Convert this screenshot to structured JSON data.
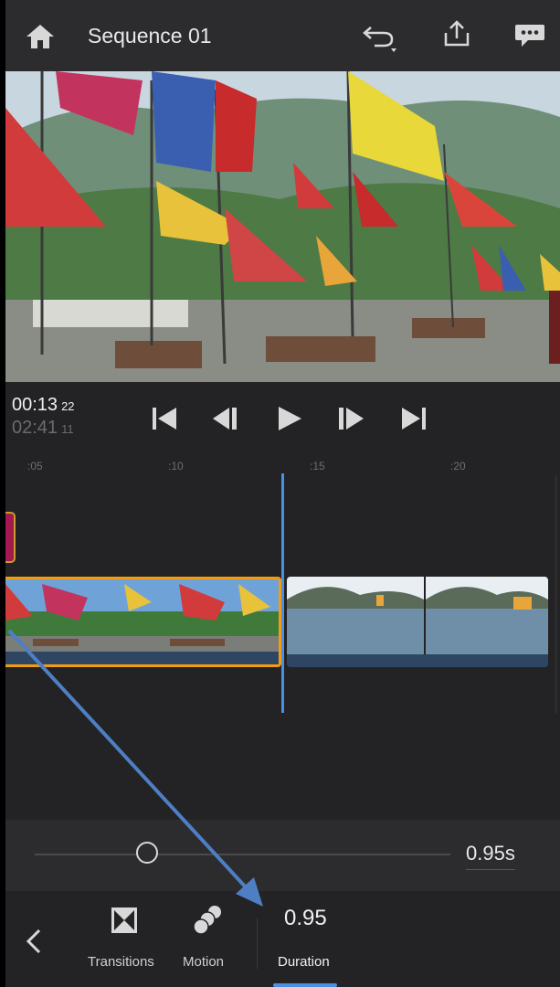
{
  "header": {
    "title": "Sequence 01",
    "icons": [
      "home-icon",
      "undo-icon",
      "share-icon",
      "feedback-icon"
    ]
  },
  "playback": {
    "current_time": "00:13",
    "current_frames": "22",
    "total_time": "02:41",
    "total_frames": "11",
    "controls": [
      "skip-to-start-icon",
      "step-back-icon",
      "play-icon",
      "step-forward-icon",
      "skip-to-end-icon"
    ]
  },
  "ruler": {
    "ticks": [
      ":05",
      ":10",
      ":15",
      ":20"
    ]
  },
  "slider": {
    "value_label": "0.95s",
    "position_fraction": 0.25
  },
  "toolbar": {
    "transitions_label": "Transitions",
    "motion_label": "Motion",
    "duration_value": "0.95",
    "duration_label": "Duration"
  },
  "colors": {
    "accent_blue": "#4a90e2",
    "selected_clip_border": "#f39c12",
    "marker": "#a3184f"
  }
}
